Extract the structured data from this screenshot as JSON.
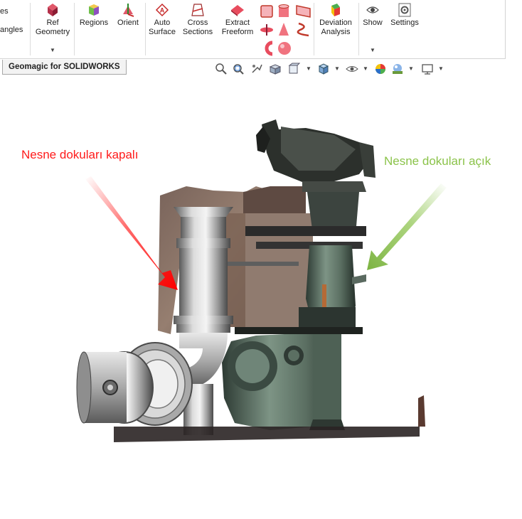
{
  "ribbon": {
    "cut_left_top": "es",
    "cut_left_bottom": "angles",
    "buttons": {
      "ref_geometry": [
        "Ref",
        "Geometry"
      ],
      "regions": "Regions",
      "orient": "Orient",
      "auto_surface": [
        "Auto",
        "Surface"
      ],
      "cross_sections": [
        "Cross",
        "Sections"
      ],
      "extract_freeform": [
        "Extract",
        "Freeform"
      ],
      "deviation_analysis": [
        "Deviation",
        "Analysis"
      ],
      "show": "Show",
      "settings": "Settings"
    }
  },
  "tab": {
    "label": "Geomagic for SOLIDWORKS"
  },
  "annotations": {
    "left": "Nesne dokuları kapalı",
    "right": "Nesne dokuları açık"
  },
  "colors": {
    "left_label": "#ff1a1a",
    "right_label": "#8bc34a"
  }
}
